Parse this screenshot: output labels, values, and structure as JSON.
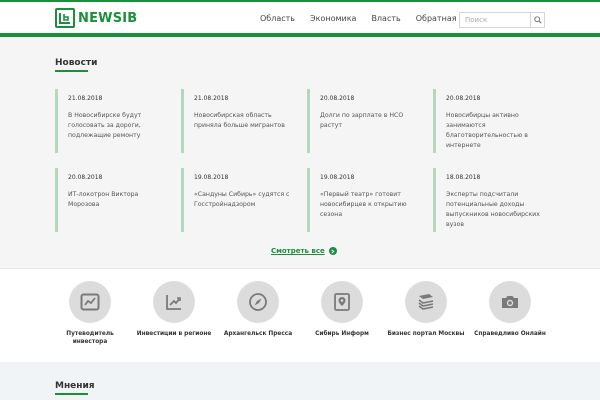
{
  "header": {
    "logo_text": "NEWSIB",
    "nav": [
      "Область",
      "Экономика",
      "Власть",
      "Обратная связь"
    ],
    "search_placeholder": "Поиск"
  },
  "news": {
    "title": "Новости",
    "items": [
      {
        "date": "21.08.2018",
        "text": "В Новосибирске будут голосовать за дороги, подлежащие ремонту"
      },
      {
        "date": "21.08.2018",
        "text": "Новосибирская область приняла больше мигрантов"
      },
      {
        "date": "20.08.2018",
        "text": "Долги по зарплате в НСО растут"
      },
      {
        "date": "20.08.2018",
        "text": "Новосибирцы активно занимаются благотворительностью в интернете"
      },
      {
        "date": "20.08.2018",
        "text": "ИТ-локотрон Виктора Морозова"
      },
      {
        "date": "19.08.2018",
        "text": "«Сандуны Сибирь» судятся с Госстройнадзором"
      },
      {
        "date": "19.08.2018",
        "text": "«Первый театр» готовит новосибирцев к открытию сезона"
      },
      {
        "date": "18.08.2018",
        "text": "Эксперты подсчитали потенциальные доходы выпускников новосибирских вузов"
      }
    ],
    "more_label": "Смотреть все"
  },
  "partners": [
    {
      "label": "Путеводитель инвестора",
      "icon": "chart-frame-icon"
    },
    {
      "label": "Инвестиции в регионе",
      "icon": "trend-up-icon"
    },
    {
      "label": "Архангельск Пресса",
      "icon": "compass-icon"
    },
    {
      "label": "Сибирь Информ",
      "icon": "map-pin-icon"
    },
    {
      "label": "Бизнес портал Москвы",
      "icon": "layers-icon"
    },
    {
      "label": "Справедливо Онлайн",
      "icon": "camera-icon"
    }
  ],
  "opinions": {
    "title": "Мнения"
  },
  "colors": {
    "accent": "#1a8f3c",
    "card_border": "#b5d6bf",
    "background": "#f5f5f5"
  }
}
